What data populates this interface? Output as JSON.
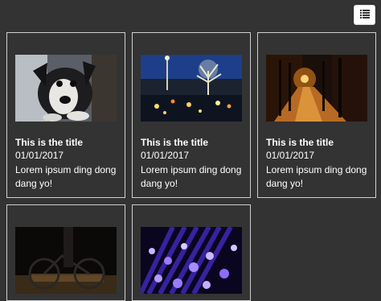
{
  "toolbar": {
    "view_toggle_icon": "list-icon"
  },
  "cards": [
    {
      "title": "This is the title",
      "date": "01/01/2017",
      "description": "Lorem ipsum ding dong dang yo!",
      "image": "puppy-photo"
    },
    {
      "title": "This is the title",
      "date": "01/01/2017",
      "description": "Lorem ipsum ding dong dang yo!",
      "image": "night-park-lights-photo"
    },
    {
      "title": "This is the title",
      "date": "01/01/2017",
      "description": "Lorem ipsum ding dong dang yo!",
      "image": "autumn-path-photo"
    },
    {
      "image": "bicycle-silhouette-photo"
    },
    {
      "image": "fiber-optic-lights-photo"
    }
  ]
}
